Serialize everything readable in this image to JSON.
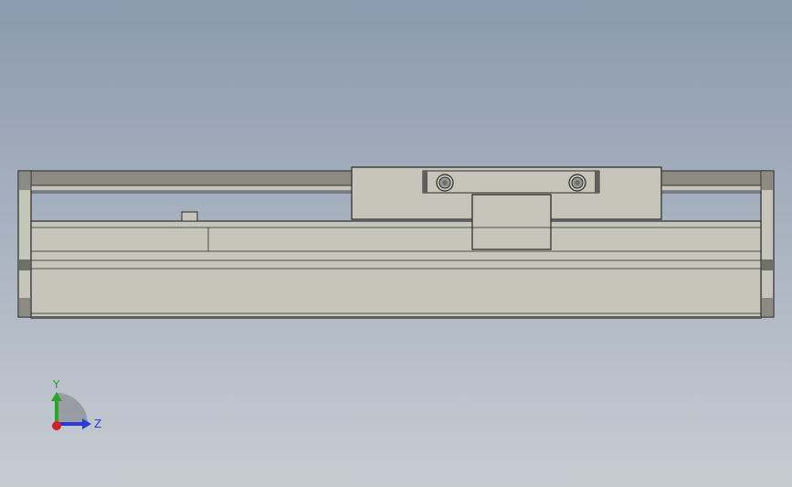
{
  "viewport": {
    "background_top": "#8b9aae",
    "background_bottom": "#c7ccd3",
    "part_fill": "#c5c6b9",
    "part_edge": "#2b2b2b",
    "rail_fill": "#8b8b84"
  },
  "triad": {
    "y_label": "Y",
    "z_label": "Z",
    "y_color": "#2aa52a",
    "z_color": "#2b3bd1",
    "x_color": "#d42020"
  }
}
